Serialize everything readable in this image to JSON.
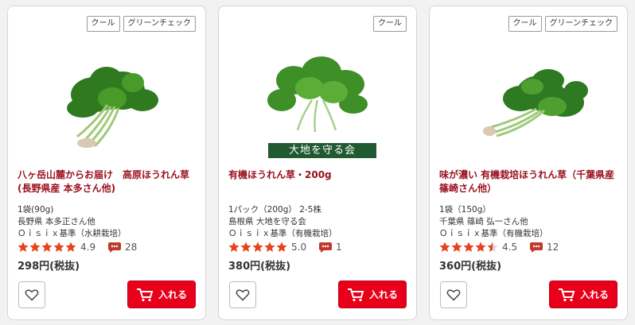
{
  "products": [
    {
      "tags": [
        "クール",
        "グリーンチェック"
      ],
      "title": "八ヶ岳山麓からお届け　高原ほうれん草(長野県産 本多さん他)",
      "qty": "1袋(90g)",
      "producer": "長野県 本多正さん他",
      "standard": "Ｏｉｓｉｘ基準（水耕栽培）",
      "rating": 4.9,
      "rating_text": "4.9",
      "comments": "28",
      "price": "298円(税抜)",
      "cart_label": "入れる",
      "banner": ""
    },
    {
      "tags": [
        "クール"
      ],
      "title": "有機ほうれん草・200g",
      "qty": "1パック（200g） 2-5株",
      "producer": "島根県 大地を守る会",
      "standard": "Ｏｉｓｉｘ基準（有機栽培）",
      "rating": 5.0,
      "rating_text": "5.0",
      "comments": "1",
      "price": "380円(税抜)",
      "cart_label": "入れる",
      "banner": "大地を守る会"
    },
    {
      "tags": [
        "クール",
        "グリーンチェック"
      ],
      "title": "味が濃い 有機栽培ほうれん草（千葉県産 篠崎さん他）",
      "qty": "1袋（150g）",
      "producer": "千葉県 篠崎 弘一さん他",
      "standard": "Ｏｉｓｉｘ基準（有機栽培）",
      "rating": 4.5,
      "rating_text": "4.5",
      "comments": "12",
      "price": "360円(税抜)",
      "cart_label": "入れる",
      "banner": ""
    }
  ],
  "colors": {
    "star": "#e8421a",
    "accent": "#e8001a",
    "title": "#9a0f1c"
  },
  "icons": {
    "favorite": "heart-icon",
    "cart": "cart-icon",
    "comment": "comment-icon",
    "star": "star-icon"
  }
}
